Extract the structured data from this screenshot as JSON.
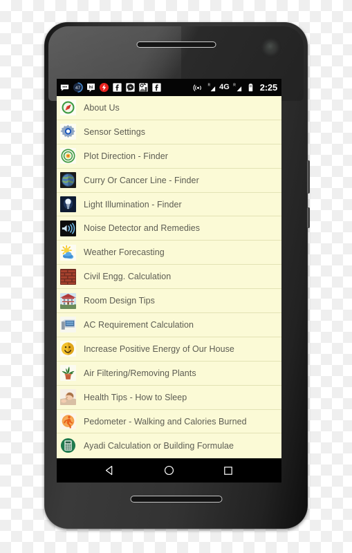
{
  "device": {
    "type": "android-smartphone",
    "earpiece": "speaker-grille",
    "camera": "front-camera"
  },
  "status_bar": {
    "clock": "2:25",
    "network_label": "4G",
    "roaming_label": "R",
    "notification_icons": [
      "sms-messages-icon",
      "badge-count-47-icon",
      "hike-messenger-icon",
      "red-flash-app-icon",
      "facebook-icon",
      "facebook-messenger-icon",
      "app-notification-icon",
      "facebook-icon-2"
    ],
    "system_icons": [
      "hotspot-icon",
      "signal-bars-sim1-icon",
      "network-4g-icon",
      "signal-bars-sim2-icon",
      "battery-icon"
    ],
    "badge_count": "47",
    "colors": {
      "background": "#050505",
      "text": "#ffffff"
    }
  },
  "list": {
    "background": "#fbfad6",
    "divider": "#e2e2b4",
    "text_color": "#5c5c52",
    "items": [
      {
        "label": "About Us",
        "icon": "compass-icon"
      },
      {
        "label": "Sensor Settings",
        "icon": "gear-settings-icon"
      },
      {
        "label": "Plot Direction - Finder",
        "icon": "target-circle-icon"
      },
      {
        "label": "Curry Or Cancer Line - Finder",
        "icon": "globe-earth-icon"
      },
      {
        "label": "Light Illumination - Finder",
        "icon": "light-bulb-icon"
      },
      {
        "label": "Noise Detector and Remedies",
        "icon": "sound-waves-icon"
      },
      {
        "label": "Weather Forecasting",
        "icon": "sun-cloud-icon"
      },
      {
        "label": "Civil Engg. Calculation",
        "icon": "brick-wall-icon"
      },
      {
        "label": "Room Design Tips",
        "icon": "house-icon"
      },
      {
        "label": "AC Requirement Calculation",
        "icon": "air-conditioner-icon"
      },
      {
        "label": "Increase Positive Energy of Our House",
        "icon": "smiley-face-icon"
      },
      {
        "label": "Air Filtering/Removing Plants",
        "icon": "potted-plant-icon"
      },
      {
        "label": "Health Tips - How to Sleep",
        "icon": "sleeping-baby-icon"
      },
      {
        "label": "Pedometer - Walking and Calories Burned",
        "icon": "running-person-icon"
      },
      {
        "label": "Ayadi Calculation or Building Formulae",
        "icon": "calculator-icon"
      }
    ]
  },
  "nav_bar": {
    "buttons": [
      {
        "name": "back",
        "icon": "triangle-back-icon"
      },
      {
        "name": "home",
        "icon": "circle-home-icon"
      },
      {
        "name": "recents",
        "icon": "square-recents-icon"
      }
    ],
    "background": "#000000"
  }
}
